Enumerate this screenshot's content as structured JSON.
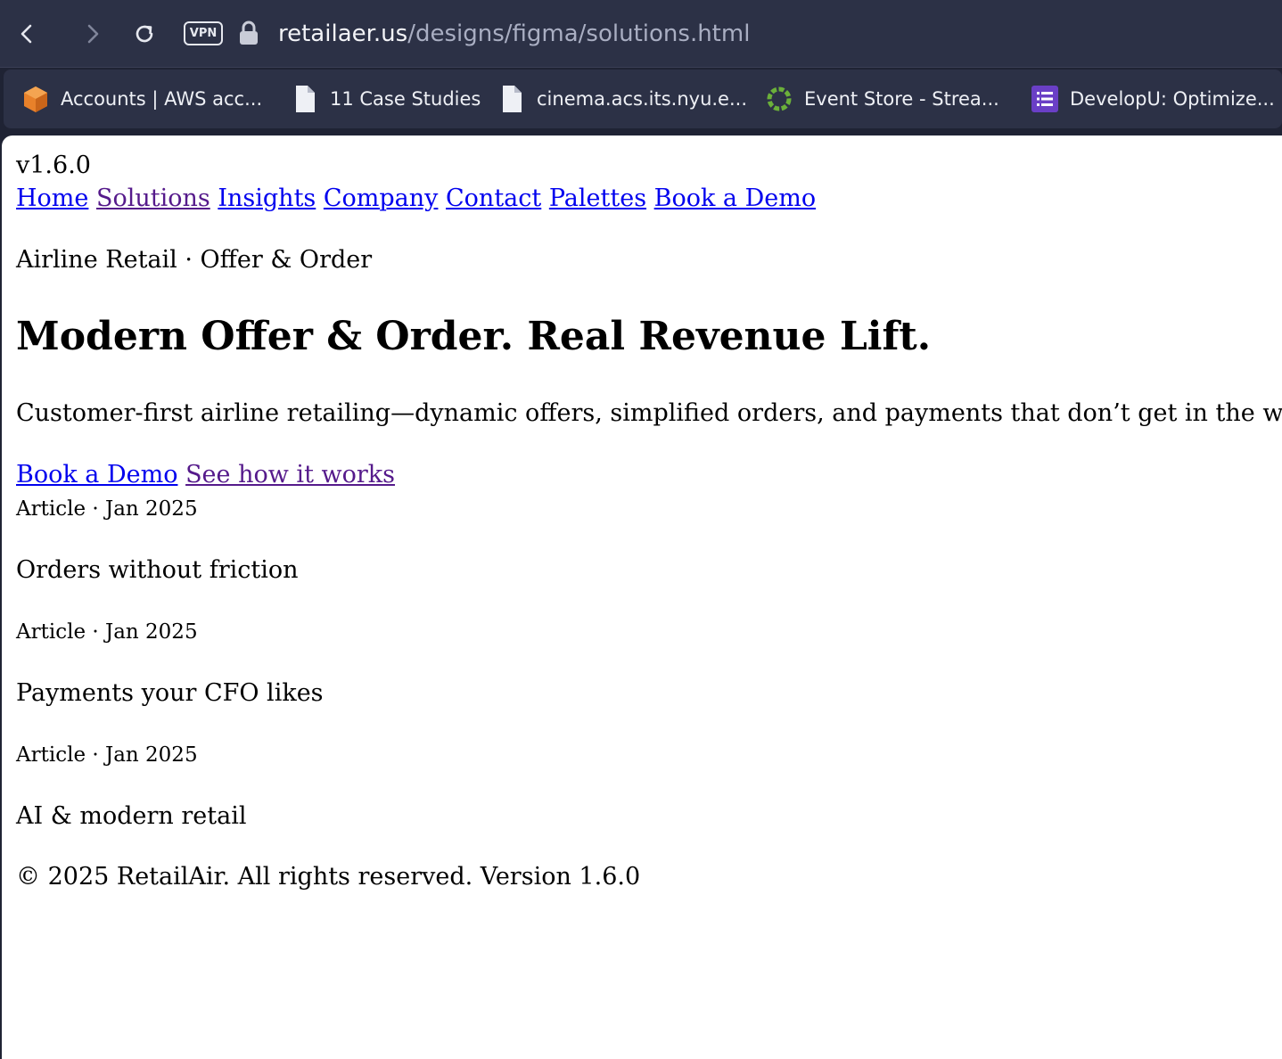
{
  "browser": {
    "url_host": "retailaer.us",
    "url_path": "/designs/figma/solutions.html",
    "vpn_label": "VPN",
    "icons": [
      "back-icon",
      "forward-icon",
      "reload-icon",
      "lock-icon"
    ]
  },
  "bookmarks": [
    {
      "label": "Accounts | AWS acc...",
      "icon": "aws-cube-icon"
    },
    {
      "label": "11 Case Studies",
      "icon": "document-icon"
    },
    {
      "label": "cinema.acs.its.nyu.e...",
      "icon": "document-icon"
    },
    {
      "label": "Event Store - Strea...",
      "icon": "event-store-icon"
    },
    {
      "label": "DevelopU: Optimize...",
      "icon": "list-icon"
    }
  ],
  "page": {
    "version": "v1.6.0",
    "nav": [
      "Home",
      "Solutions",
      "Insights",
      "Company",
      "Contact",
      "Palettes",
      "Book a Demo"
    ],
    "eyebrow": "Airline Retail · Offer & Order",
    "heading": "Modern Offer & Order. Real Revenue Lift.",
    "lede": "Customer-first airline retailing—dynamic offers, simplified orders, and payments that don’t get in the way.",
    "cta_primary": "Book a Demo",
    "cta_secondary": "See how it works",
    "articles": [
      {
        "meta": "Article · Jan 2025",
        "title": "Orders without friction"
      },
      {
        "meta": "Article · Jan 2025",
        "title": "Payments your CFO likes"
      },
      {
        "meta": "Article · Jan 2025",
        "title": "AI & modern retail"
      }
    ],
    "footer": "© 2025 RetailAir. All rights reserved. Version 1.6.0"
  },
  "colors": {
    "chrome_bg": "#2c3146",
    "link": "#0000ee",
    "visited_link": "#551a8b"
  }
}
